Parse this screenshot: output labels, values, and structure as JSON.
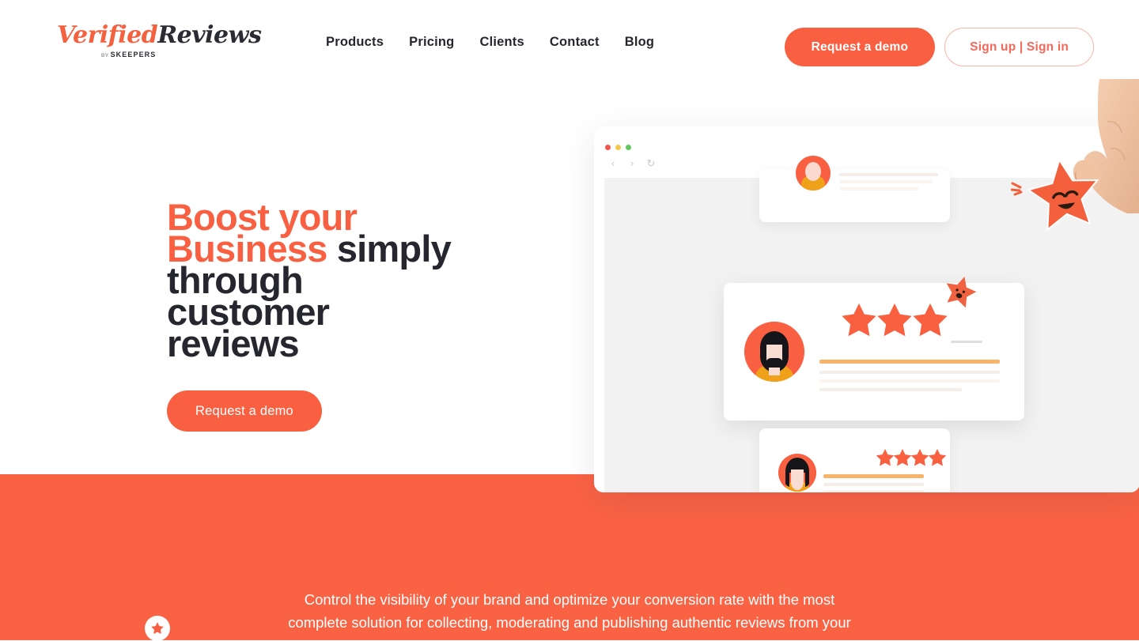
{
  "brand": {
    "logo_word_1": "Verified",
    "logo_word_2": "Reviews",
    "logo_by": "BY ",
    "logo_parent": "SKEEPERS",
    "accent_color": "#F96042",
    "band_color": "#FA6244",
    "dark_text_color": "#26262E"
  },
  "header": {
    "nav": [
      {
        "label": "Products"
      },
      {
        "label": "Pricing"
      },
      {
        "label": "Clients"
      },
      {
        "label": "Contact"
      },
      {
        "label": "Blog"
      }
    ],
    "demo_button": "Request a demo",
    "signin_button": "Sign up | Sign in"
  },
  "hero": {
    "title_line_1_highlight": "Boost your",
    "title_line_2_highlight": "Business",
    "title_line_2_rest": " simply",
    "title_line_3": "through",
    "title_line_4": "customer",
    "title_line_5": "reviews",
    "cta_button": "Request a demo"
  },
  "mockup": {
    "window_controls": [
      "close-dot",
      "minimize-dot",
      "maximize-dot"
    ],
    "back_icon": "‹",
    "forward_icon": "›",
    "reload_icon": "↻",
    "cards": [
      {
        "name": "review-card-top",
        "stars": 0,
        "partial": true
      },
      {
        "name": "review-card-featured",
        "stars": 3,
        "partial": false
      },
      {
        "name": "review-card-bottom",
        "stars": 4,
        "partial": false
      }
    ],
    "mascot_alt": "smiling-star-mascot",
    "hand_alt": "hand-holding-star"
  },
  "band": {
    "paragraph_line_1": "Control the visibility of your brand and optimize your conversion rate with the most",
    "paragraph_line_2": "complete solution for collecting, moderating and publishing authentic reviews from your",
    "badge_icon": "star-badge-icon"
  }
}
